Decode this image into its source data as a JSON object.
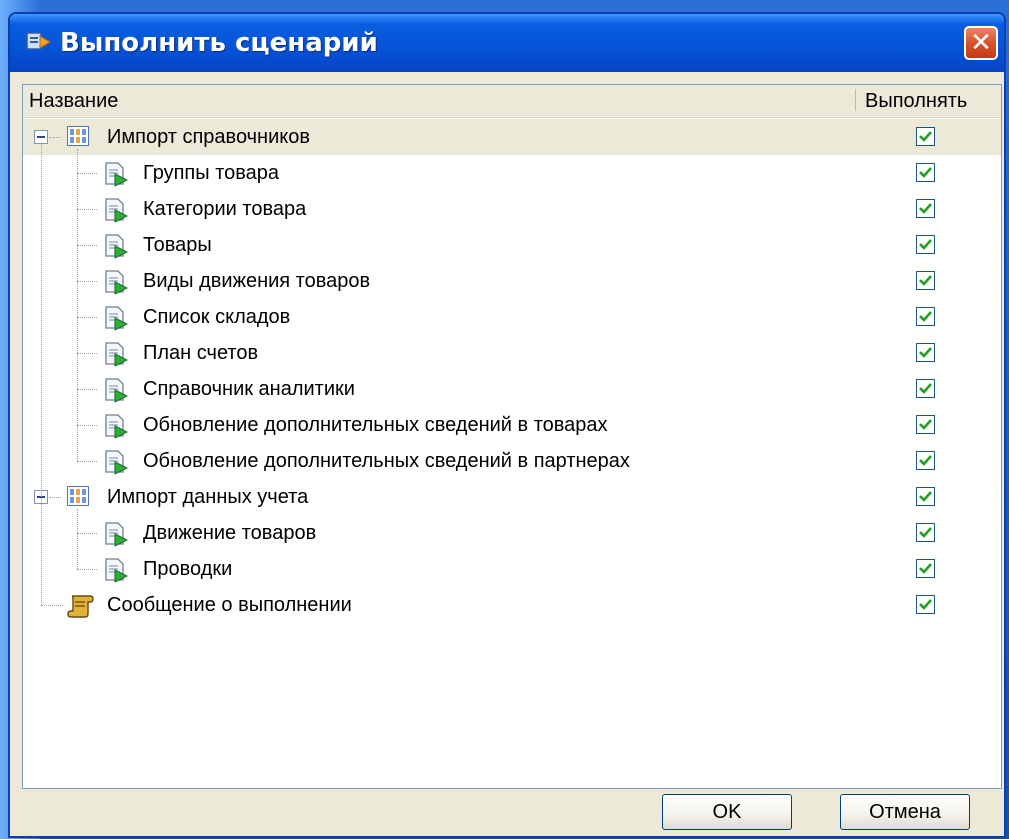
{
  "window": {
    "title": "Выполнить сценарий",
    "close_glyph": "✕"
  },
  "columns": {
    "name": "Название",
    "execute": "Выполнять"
  },
  "tree": [
    {
      "level": 0,
      "type": "group",
      "label": "Импорт справочников",
      "checked": true,
      "expanded": true,
      "selected": true
    },
    {
      "level": 1,
      "type": "doc",
      "label": "Группы товара",
      "checked": true
    },
    {
      "level": 1,
      "type": "doc",
      "label": "Категории товара",
      "checked": true
    },
    {
      "level": 1,
      "type": "doc",
      "label": "Товары",
      "checked": true
    },
    {
      "level": 1,
      "type": "doc",
      "label": "Виды движения товаров",
      "checked": true
    },
    {
      "level": 1,
      "type": "doc",
      "label": "Список складов",
      "checked": true
    },
    {
      "level": 1,
      "type": "doc",
      "label": "План счетов",
      "checked": true
    },
    {
      "level": 1,
      "type": "doc",
      "label": "Справочник аналитики",
      "checked": true
    },
    {
      "level": 1,
      "type": "doc",
      "label": "Обновление дополнительных сведений в товарах",
      "checked": true
    },
    {
      "level": 1,
      "type": "doc",
      "label": "Обновление дополнительных сведений в партнерах",
      "checked": true
    },
    {
      "level": 0,
      "type": "group",
      "label": "Импорт данных учета",
      "checked": true,
      "expanded": true
    },
    {
      "level": 1,
      "type": "doc",
      "label": "Движение товаров",
      "checked": true
    },
    {
      "level": 1,
      "type": "doc",
      "label": "Проводки",
      "checked": true
    },
    {
      "level": 0,
      "type": "scroll",
      "label": "Сообщение о выполнении",
      "checked": true
    }
  ],
  "buttons": {
    "ok": "OK",
    "cancel": "Отмена"
  },
  "colors": {
    "titlebar": "#0553d6",
    "window_bg": "#ece9d8",
    "checkmark": "#21a121"
  }
}
